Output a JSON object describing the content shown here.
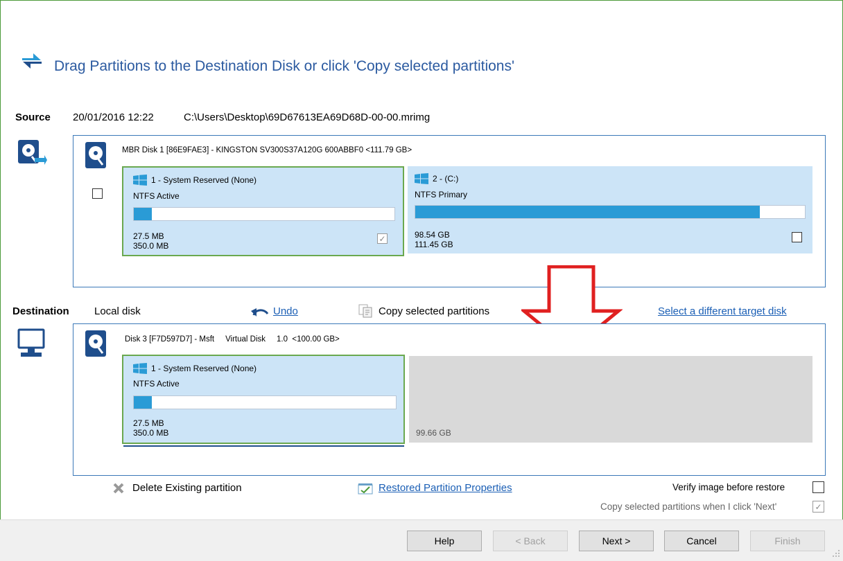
{
  "title": "Drag Partitions to the Destination Disk or click 'Copy selected partitions'",
  "source": {
    "label": "Source",
    "date": "20/01/2016 12:22",
    "path": "C:\\Users\\Desktop\\69D67613EA69D68D-00-00.mrimg",
    "disk_header": "MBR Disk 1 [86E9FAE3] - KINGSTON SV300S37A120G 600ABBF0  <111.79 GB>",
    "partitions": [
      {
        "name": "1 - System Reserved (None)",
        "type": "NTFS Active",
        "used": "27.5 MB",
        "total": "350.0 MB",
        "fill": 0.07
      },
      {
        "name": "2 - (C:)",
        "type": "NTFS Primary",
        "used": "98.54 GB",
        "total": "111.45 GB",
        "fill": 0.884
      }
    ]
  },
  "destination": {
    "label": "Destination",
    "type": "Local disk",
    "undo": "Undo",
    "copy_selected": "Copy selected partitions",
    "select_target": "Select a different target disk",
    "disk_header": "Disk 3 [F7D597D7] - Msft     Virtual Disk     1.0  <100.00 GB>",
    "partition": {
      "name": "1 - System Reserved (None)",
      "type": "NTFS Active",
      "used": "27.5 MB",
      "total": "350.0 MB",
      "fill": 0.07
    },
    "unallocated": "99.66 GB"
  },
  "actions": {
    "delete_existing": "Delete Existing partition",
    "restored_props": "Restored Partition Properties",
    "verify": "Verify image before restore",
    "copy_on_next": "Copy selected partitions when I click 'Next'"
  },
  "buttons": {
    "help": "Help",
    "back": "< Back",
    "next": "Next >",
    "cancel": "Cancel",
    "finish": "Finish"
  },
  "colors": {
    "accent": "#2b5aa0",
    "partition_bg": "#cce4f7",
    "bar_fill": "#2a9bd6",
    "selected_border": "#6aa84f",
    "arrow": "#e02020"
  }
}
